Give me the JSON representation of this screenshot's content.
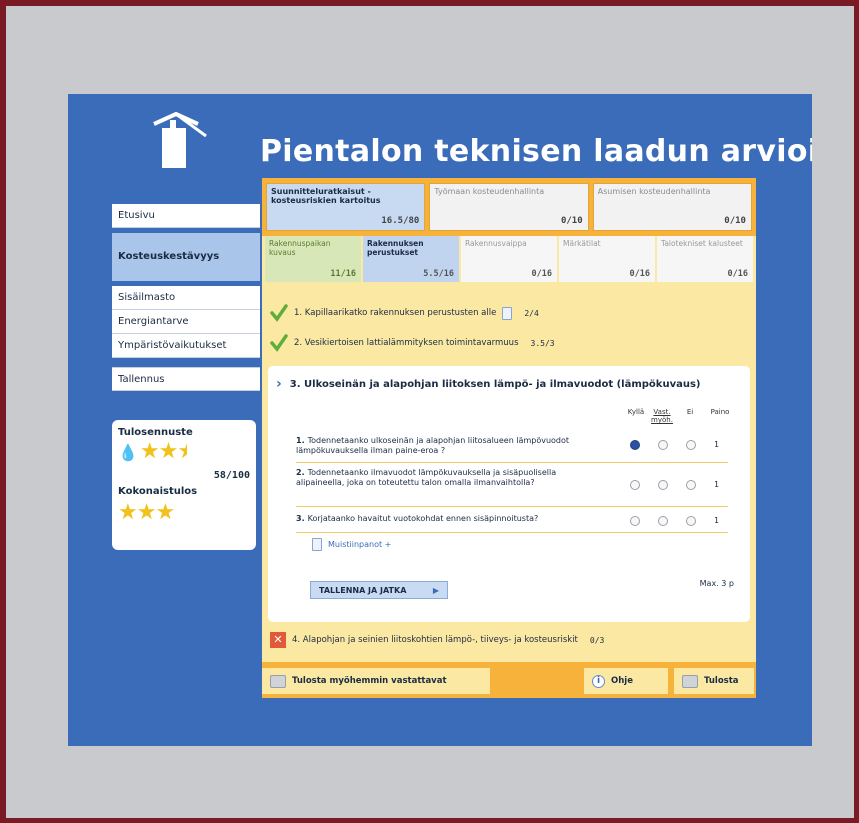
{
  "app": {
    "title": "Pientalon teknisen laadun arviointi"
  },
  "nav": {
    "items": [
      "Etusivu",
      "Kosteuskestävyys",
      "Sisäilmasto",
      "Energiantarve",
      "Ympäristövaikutukset",
      "Tallennus"
    ],
    "active_index": 1
  },
  "score": {
    "forecast_label": "Tulosennuste",
    "forecast_value": "58/100",
    "forecast_stars": 2.5,
    "overall_label": "Kokonaistulos",
    "overall_stars": 3,
    "star_icon": "star-icon",
    "drop_icon": "water-drop-icon"
  },
  "categories": [
    {
      "label": "Suunnitteluratkaisut - kosteusriskien kartoitus",
      "score": "16.5/80",
      "active": true
    },
    {
      "label": "Työmaan kosteudenhallinta",
      "score": "0/10",
      "active": false
    },
    {
      "label": "Asumisen kosteudenhallinta",
      "score": "0/10",
      "active": false
    }
  ],
  "subtabs": [
    {
      "label": "Rakennuspaikan kuvaus",
      "score": "11/16",
      "state": "done"
    },
    {
      "label": "Rakennuksen perustukset",
      "score": "5.5/16",
      "state": "active"
    },
    {
      "label": "Rakennusvaippa",
      "score": "0/16",
      "state": "none"
    },
    {
      "label": "Märkätilat",
      "score": "0/16",
      "state": "none"
    },
    {
      "label": "Talotekniset kalusteet",
      "score": "0/16",
      "state": "none"
    }
  ],
  "items": [
    {
      "label": "1. Kapillaarikatko rakennuksen perustusten alle",
      "score": "2/4"
    },
    {
      "label": "2. Vesikiertoisen lattialämmityksen toimintavarmuus",
      "score": "3.5/3"
    }
  ],
  "question_card": {
    "title": "3. Ulkoseinän ja alapohjan liitoksen lämpö- ja ilmavuodot (lämpökuvaus)",
    "columns": [
      "Kyllä",
      "Vast. myöh.",
      "Ei",
      "Paino"
    ],
    "questions": [
      {
        "num": "1.",
        "text": "Todennetaanko ulkoseinän ja alapohjan liitosalueen lämpövuodot lämpökuvauksella ilman paine-eroa ?",
        "selected": 0,
        "weight": "1"
      },
      {
        "num": "2.",
        "text": "Todennetaanko ilmavuodot lämpökuvauksella ja sisäpuolisella alipaineella, joka on toteutettu talon omalla ilmanvaihtolla?",
        "selected": -1,
        "weight": "1"
      },
      {
        "num": "3.",
        "text": "Korjataanko havaitut vuotokohdat ennen sisäpinnoitusta?",
        "selected": -1,
        "weight": "1"
      }
    ],
    "notes_link": "Muistiinpanot +",
    "save_button": "TALLENNA JA JATKA",
    "max_note": "Max. 3 p"
  },
  "item4": {
    "label": "4. Alapohjan ja seinien liitoskohtien lämpö-, tiiveys- ja kosteusriskit",
    "score": "0/3"
  },
  "bottom": {
    "print_later": "Tulosta myöhemmin vastattavat",
    "help": "Ohje",
    "print": "Tulosta"
  },
  "colors": {
    "screen_bg": "#3a6cb9",
    "panel_bg": "#fbe9a3",
    "accent_orange": "#f6b23a",
    "star": "#f1c21b"
  }
}
